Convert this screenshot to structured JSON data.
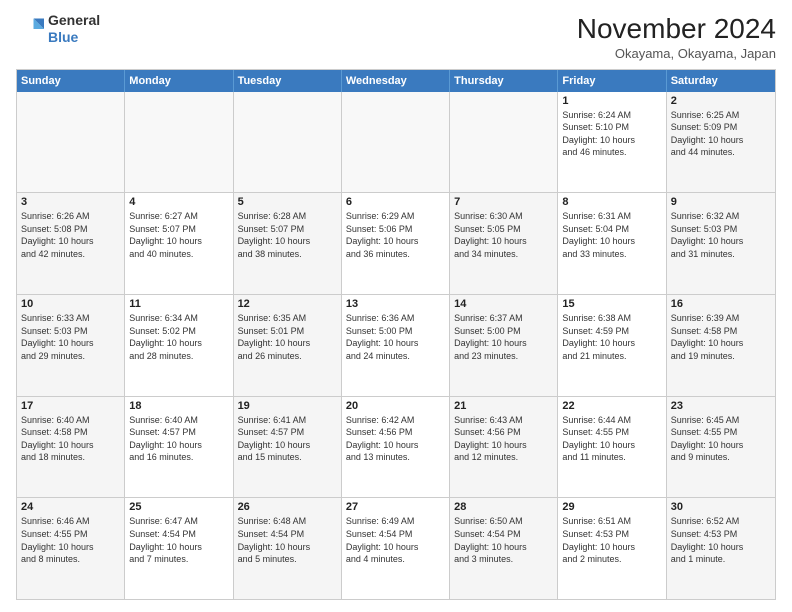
{
  "logo": {
    "line1": "General",
    "line2": "Blue"
  },
  "header": {
    "month": "November 2024",
    "location": "Okayama, Okayama, Japan"
  },
  "weekdays": [
    "Sunday",
    "Monday",
    "Tuesday",
    "Wednesday",
    "Thursday",
    "Friday",
    "Saturday"
  ],
  "rows": [
    [
      {
        "day": "",
        "info": ""
      },
      {
        "day": "",
        "info": ""
      },
      {
        "day": "",
        "info": ""
      },
      {
        "day": "",
        "info": ""
      },
      {
        "day": "",
        "info": ""
      },
      {
        "day": "1",
        "info": "Sunrise: 6:24 AM\nSunset: 5:10 PM\nDaylight: 10 hours\nand 46 minutes."
      },
      {
        "day": "2",
        "info": "Sunrise: 6:25 AM\nSunset: 5:09 PM\nDaylight: 10 hours\nand 44 minutes."
      }
    ],
    [
      {
        "day": "3",
        "info": "Sunrise: 6:26 AM\nSunset: 5:08 PM\nDaylight: 10 hours\nand 42 minutes."
      },
      {
        "day": "4",
        "info": "Sunrise: 6:27 AM\nSunset: 5:07 PM\nDaylight: 10 hours\nand 40 minutes."
      },
      {
        "day": "5",
        "info": "Sunrise: 6:28 AM\nSunset: 5:07 PM\nDaylight: 10 hours\nand 38 minutes."
      },
      {
        "day": "6",
        "info": "Sunrise: 6:29 AM\nSunset: 5:06 PM\nDaylight: 10 hours\nand 36 minutes."
      },
      {
        "day": "7",
        "info": "Sunrise: 6:30 AM\nSunset: 5:05 PM\nDaylight: 10 hours\nand 34 minutes."
      },
      {
        "day": "8",
        "info": "Sunrise: 6:31 AM\nSunset: 5:04 PM\nDaylight: 10 hours\nand 33 minutes."
      },
      {
        "day": "9",
        "info": "Sunrise: 6:32 AM\nSunset: 5:03 PM\nDaylight: 10 hours\nand 31 minutes."
      }
    ],
    [
      {
        "day": "10",
        "info": "Sunrise: 6:33 AM\nSunset: 5:03 PM\nDaylight: 10 hours\nand 29 minutes."
      },
      {
        "day": "11",
        "info": "Sunrise: 6:34 AM\nSunset: 5:02 PM\nDaylight: 10 hours\nand 28 minutes."
      },
      {
        "day": "12",
        "info": "Sunrise: 6:35 AM\nSunset: 5:01 PM\nDaylight: 10 hours\nand 26 minutes."
      },
      {
        "day": "13",
        "info": "Sunrise: 6:36 AM\nSunset: 5:00 PM\nDaylight: 10 hours\nand 24 minutes."
      },
      {
        "day": "14",
        "info": "Sunrise: 6:37 AM\nSunset: 5:00 PM\nDaylight: 10 hours\nand 23 minutes."
      },
      {
        "day": "15",
        "info": "Sunrise: 6:38 AM\nSunset: 4:59 PM\nDaylight: 10 hours\nand 21 minutes."
      },
      {
        "day": "16",
        "info": "Sunrise: 6:39 AM\nSunset: 4:58 PM\nDaylight: 10 hours\nand 19 minutes."
      }
    ],
    [
      {
        "day": "17",
        "info": "Sunrise: 6:40 AM\nSunset: 4:58 PM\nDaylight: 10 hours\nand 18 minutes."
      },
      {
        "day": "18",
        "info": "Sunrise: 6:40 AM\nSunset: 4:57 PM\nDaylight: 10 hours\nand 16 minutes."
      },
      {
        "day": "19",
        "info": "Sunrise: 6:41 AM\nSunset: 4:57 PM\nDaylight: 10 hours\nand 15 minutes."
      },
      {
        "day": "20",
        "info": "Sunrise: 6:42 AM\nSunset: 4:56 PM\nDaylight: 10 hours\nand 13 minutes."
      },
      {
        "day": "21",
        "info": "Sunrise: 6:43 AM\nSunset: 4:56 PM\nDaylight: 10 hours\nand 12 minutes."
      },
      {
        "day": "22",
        "info": "Sunrise: 6:44 AM\nSunset: 4:55 PM\nDaylight: 10 hours\nand 11 minutes."
      },
      {
        "day": "23",
        "info": "Sunrise: 6:45 AM\nSunset: 4:55 PM\nDaylight: 10 hours\nand 9 minutes."
      }
    ],
    [
      {
        "day": "24",
        "info": "Sunrise: 6:46 AM\nSunset: 4:55 PM\nDaylight: 10 hours\nand 8 minutes."
      },
      {
        "day": "25",
        "info": "Sunrise: 6:47 AM\nSunset: 4:54 PM\nDaylight: 10 hours\nand 7 minutes."
      },
      {
        "day": "26",
        "info": "Sunrise: 6:48 AM\nSunset: 4:54 PM\nDaylight: 10 hours\nand 5 minutes."
      },
      {
        "day": "27",
        "info": "Sunrise: 6:49 AM\nSunset: 4:54 PM\nDaylight: 10 hours\nand 4 minutes."
      },
      {
        "day": "28",
        "info": "Sunrise: 6:50 AM\nSunset: 4:54 PM\nDaylight: 10 hours\nand 3 minutes."
      },
      {
        "day": "29",
        "info": "Sunrise: 6:51 AM\nSunset: 4:53 PM\nDaylight: 10 hours\nand 2 minutes."
      },
      {
        "day": "30",
        "info": "Sunrise: 6:52 AM\nSunset: 4:53 PM\nDaylight: 10 hours\nand 1 minute."
      }
    ]
  ]
}
